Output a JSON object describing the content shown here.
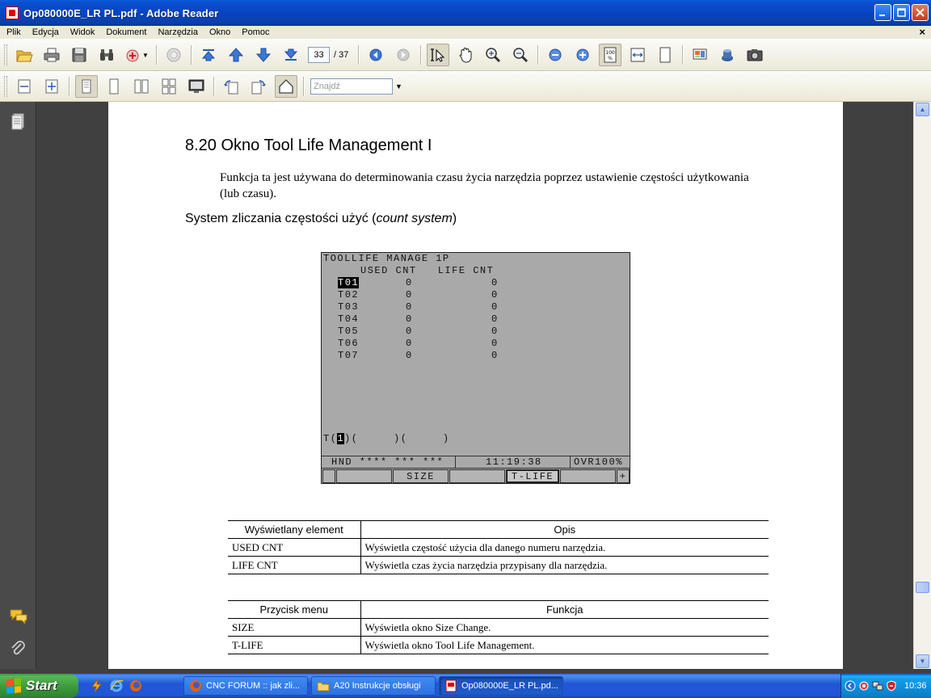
{
  "window": {
    "title": "Op080000E_LR PL.pdf - Adobe Reader"
  },
  "menu": [
    "Plik",
    "Edycja",
    "Widok",
    "Dokument",
    "Narzędzia",
    "Okno",
    "Pomoc"
  ],
  "toolbar": {
    "page_current": "33",
    "page_total": "/ 37",
    "find_placeholder": "Znajdź"
  },
  "document": {
    "heading": "8.20  Okno Tool Life Management I",
    "paragraph": "Funkcja ta jest używana do determinowania czasu życia narzędzia poprzez ustawienie częstości użytkowania (lub czasu).",
    "subheading_prefix": "System zliczania częstości użyć (",
    "subheading_italic": "count system",
    "subheading_suffix": ")"
  },
  "cnc": {
    "title": "TOOLLIFE MANAGE 1P",
    "columns": "USED CNT   LIFE CNT",
    "rows": [
      {
        "tool": "T01",
        "used": "0",
        "life": "0"
      },
      {
        "tool": "T02",
        "used": "0",
        "life": "0"
      },
      {
        "tool": "T03",
        "used": "0",
        "life": "0"
      },
      {
        "tool": "T04",
        "used": "0",
        "life": "0"
      },
      {
        "tool": "T05",
        "used": "0",
        "life": "0"
      },
      {
        "tool": "T06",
        "used": "0",
        "life": "0"
      },
      {
        "tool": "T07",
        "used": "0",
        "life": "0"
      }
    ],
    "input_prefix": "T(",
    "input_value": "1",
    "input_rest": ")(     )(     )",
    "status_mode": "HND **** *** ***",
    "status_time": "11:19:38",
    "status_ovr": "OVR100%",
    "softkeys": [
      "",
      "",
      "SIZE",
      "",
      "T-LIFE",
      "",
      "+"
    ]
  },
  "table1": {
    "headers": [
      "Wyświetlany element",
      "Opis"
    ],
    "rows": [
      [
        "USED CNT",
        "Wyświetla częstość użycia dla danego numeru narzędzia."
      ],
      [
        "LIFE CNT",
        "Wyświetla czas życia narzędzia przypisany dla narzędzia."
      ]
    ]
  },
  "table2": {
    "headers": [
      "Przycisk menu",
      "Funkcja"
    ],
    "rows": [
      [
        "SIZE",
        "Wyświetla okno Size Change."
      ],
      [
        "T-LIFE",
        "Wyświetla okno Tool Life Management."
      ]
    ]
  },
  "taskbar": {
    "start": "Start",
    "tasks": [
      {
        "label": "CNC FORUM :: jak zli...",
        "icon": "firefox-icon"
      },
      {
        "label": "A20 Instrukcje obsługi",
        "icon": "folder-icon"
      },
      {
        "label": "Op080000E_LR PL.pd...",
        "icon": "pdf-icon"
      }
    ],
    "clock": "10:36"
  }
}
